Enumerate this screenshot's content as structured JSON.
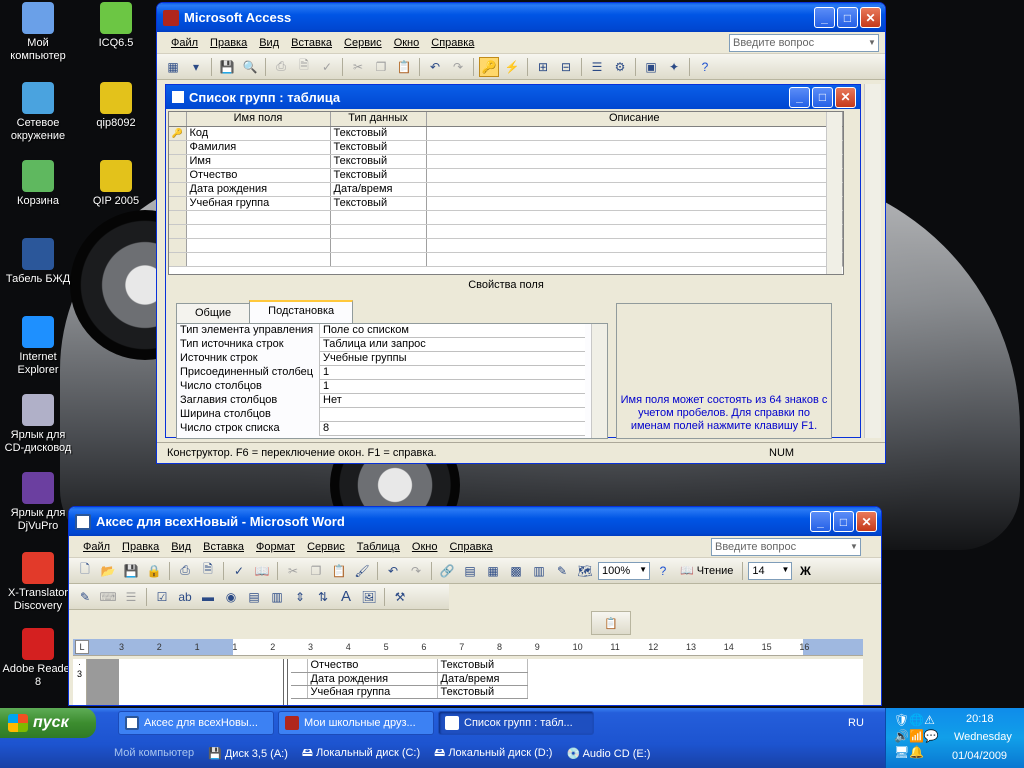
{
  "desktop_icons": [
    {
      "label": "Мой компьютер"
    },
    {
      "label": "ICQ6.5"
    },
    {
      "label": "Сетевое окружение"
    },
    {
      "label": "qip8092"
    },
    {
      "label": "Корзина"
    },
    {
      "label": "QIP 2005"
    },
    {
      "label": "Табель БЖД"
    },
    {
      "label": "Internet Explorer"
    },
    {
      "label": "Ярлык для CD-дисковод"
    },
    {
      "label": "Ярлык для DjVuPro"
    },
    {
      "label": "X-Translator Discovery"
    },
    {
      "label": "Adobe Reader 8"
    }
  ],
  "access": {
    "title": "Microsoft Access",
    "menu": [
      "Файл",
      "Правка",
      "Вид",
      "Вставка",
      "Сервис",
      "Окно",
      "Справка"
    ],
    "ask_placeholder": "Введите вопрос",
    "table_window": {
      "title": "Список групп : таблица",
      "columns": [
        "Имя поля",
        "Тип данных",
        "Описание"
      ],
      "rows": [
        {
          "field": "Код",
          "type": "Текстовый",
          "desc": "",
          "key": true
        },
        {
          "field": "Фамилия",
          "type": "Текстовый",
          "desc": ""
        },
        {
          "field": "Имя",
          "type": "Текстовый",
          "desc": ""
        },
        {
          "field": "Отчество",
          "type": "Текстовый",
          "desc": ""
        },
        {
          "field": "Дата рождения",
          "type": "Дата/время",
          "desc": ""
        },
        {
          "field": "Учебная группа",
          "type": "Текстовый",
          "desc": ""
        }
      ],
      "props_caption": "Свойства поля",
      "tabs": [
        "Общие",
        "Подстановка"
      ],
      "props": [
        {
          "label": "Тип элемента управления",
          "value": "Поле со списком"
        },
        {
          "label": "Тип источника строк",
          "value": "Таблица или запрос"
        },
        {
          "label": "Источник строк",
          "value": "Учебные группы"
        },
        {
          "label": "Присоединенный столбец",
          "value": "1"
        },
        {
          "label": "Число столбцов",
          "value": "1"
        },
        {
          "label": "Заглавия столбцов",
          "value": "Нет"
        },
        {
          "label": "Ширина столбцов",
          "value": ""
        },
        {
          "label": "Число строк списка",
          "value": "8"
        }
      ],
      "hint": "Имя поля может состоять из 64 знаков с учетом пробелов.  Для справки по именам полей нажмите клавишу F1."
    },
    "status": "Конструктор.  F6 = переключение окон.  F1 = справка.",
    "status_num": "NUM"
  },
  "word": {
    "title": "Аксес для всехНовый - Microsoft Word",
    "menu": [
      "Файл",
      "Правка",
      "Вид",
      "Вставка",
      "Формат",
      "Сервис",
      "Таблица",
      "Окно",
      "Справка"
    ],
    "ask_placeholder": "Введите вопрос",
    "zoom": "100%",
    "read_label": "Чтение",
    "font_size": "14",
    "bold_label": "Ж",
    "ruler_marks": [
      "3",
      "2",
      "1",
      "1",
      "2",
      "3",
      "4",
      "5",
      "6",
      "7",
      "8",
      "9",
      "10",
      "11",
      "12",
      "13",
      "14",
      "15",
      "16"
    ],
    "doc_rows": [
      {
        "field": "Отчество",
        "type": "Текстовый"
      },
      {
        "field": "Дата рождения",
        "type": "Дата/время"
      },
      {
        "field": "Учебная группа",
        "type": "Текстовый"
      }
    ]
  },
  "taskbar": {
    "start_label": "пуск",
    "tasks": [
      {
        "label": "Аксес для всехНовы..."
      },
      {
        "label": "Мои школьные друз..."
      },
      {
        "label": "Список групп : табл..."
      }
    ],
    "lang": "RU",
    "time": "20:18",
    "day": "Wednesday",
    "date": "01/04/2009",
    "drives": [
      "Мой компьютер",
      "Диск 3,5 (A:)",
      "Локальный диск (C:)",
      "Локальный диск (D:)",
      "Audio CD (E:)"
    ]
  }
}
